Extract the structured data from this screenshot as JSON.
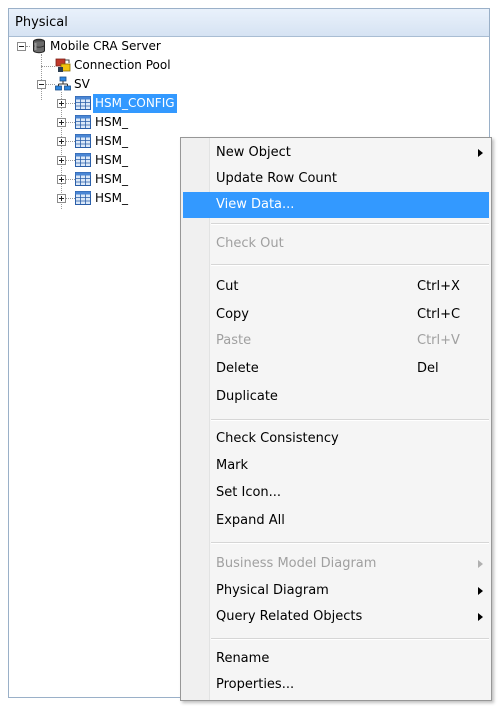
{
  "panel": {
    "title": "Physical"
  },
  "tree": {
    "root_label": "Mobile CRA Server",
    "connection_pool_label": "Connection Pool",
    "schema_label": "SV",
    "tables": [
      {
        "label": "HSM_CONFIG"
      },
      {
        "label": "HSM_"
      },
      {
        "label": "HSM_"
      },
      {
        "label": "HSM_"
      },
      {
        "label": "HSM_"
      },
      {
        "label": "HSM_"
      }
    ]
  },
  "context_menu": {
    "items": [
      {
        "label": "New Object",
        "submenu": true
      },
      {
        "label": "Update Row Count"
      },
      {
        "label": "View Data...",
        "highlighted": true
      },
      {
        "label": "Check Out",
        "disabled": true
      },
      {
        "label": "Cut",
        "shortcut": "Ctrl+X"
      },
      {
        "label": "Copy",
        "shortcut": "Ctrl+C"
      },
      {
        "label": "Paste",
        "shortcut": "Ctrl+V",
        "disabled": true
      },
      {
        "label": "Delete",
        "shortcut": "Del"
      },
      {
        "label": "Duplicate"
      },
      {
        "label": "Check Consistency"
      },
      {
        "label": "Mark"
      },
      {
        "label": "Set Icon..."
      },
      {
        "label": "Expand All"
      },
      {
        "label": "Business Model Diagram",
        "submenu": true,
        "disabled": true
      },
      {
        "label": "Physical Diagram",
        "submenu": true
      },
      {
        "label": "Query Related Objects",
        "submenu": true
      },
      {
        "label": "Rename"
      },
      {
        "label": "Properties..."
      }
    ]
  },
  "colors": {
    "selection": "#3399ff",
    "menu_background": "#f5f5f5",
    "disabled_text": "#a0a0a0"
  }
}
